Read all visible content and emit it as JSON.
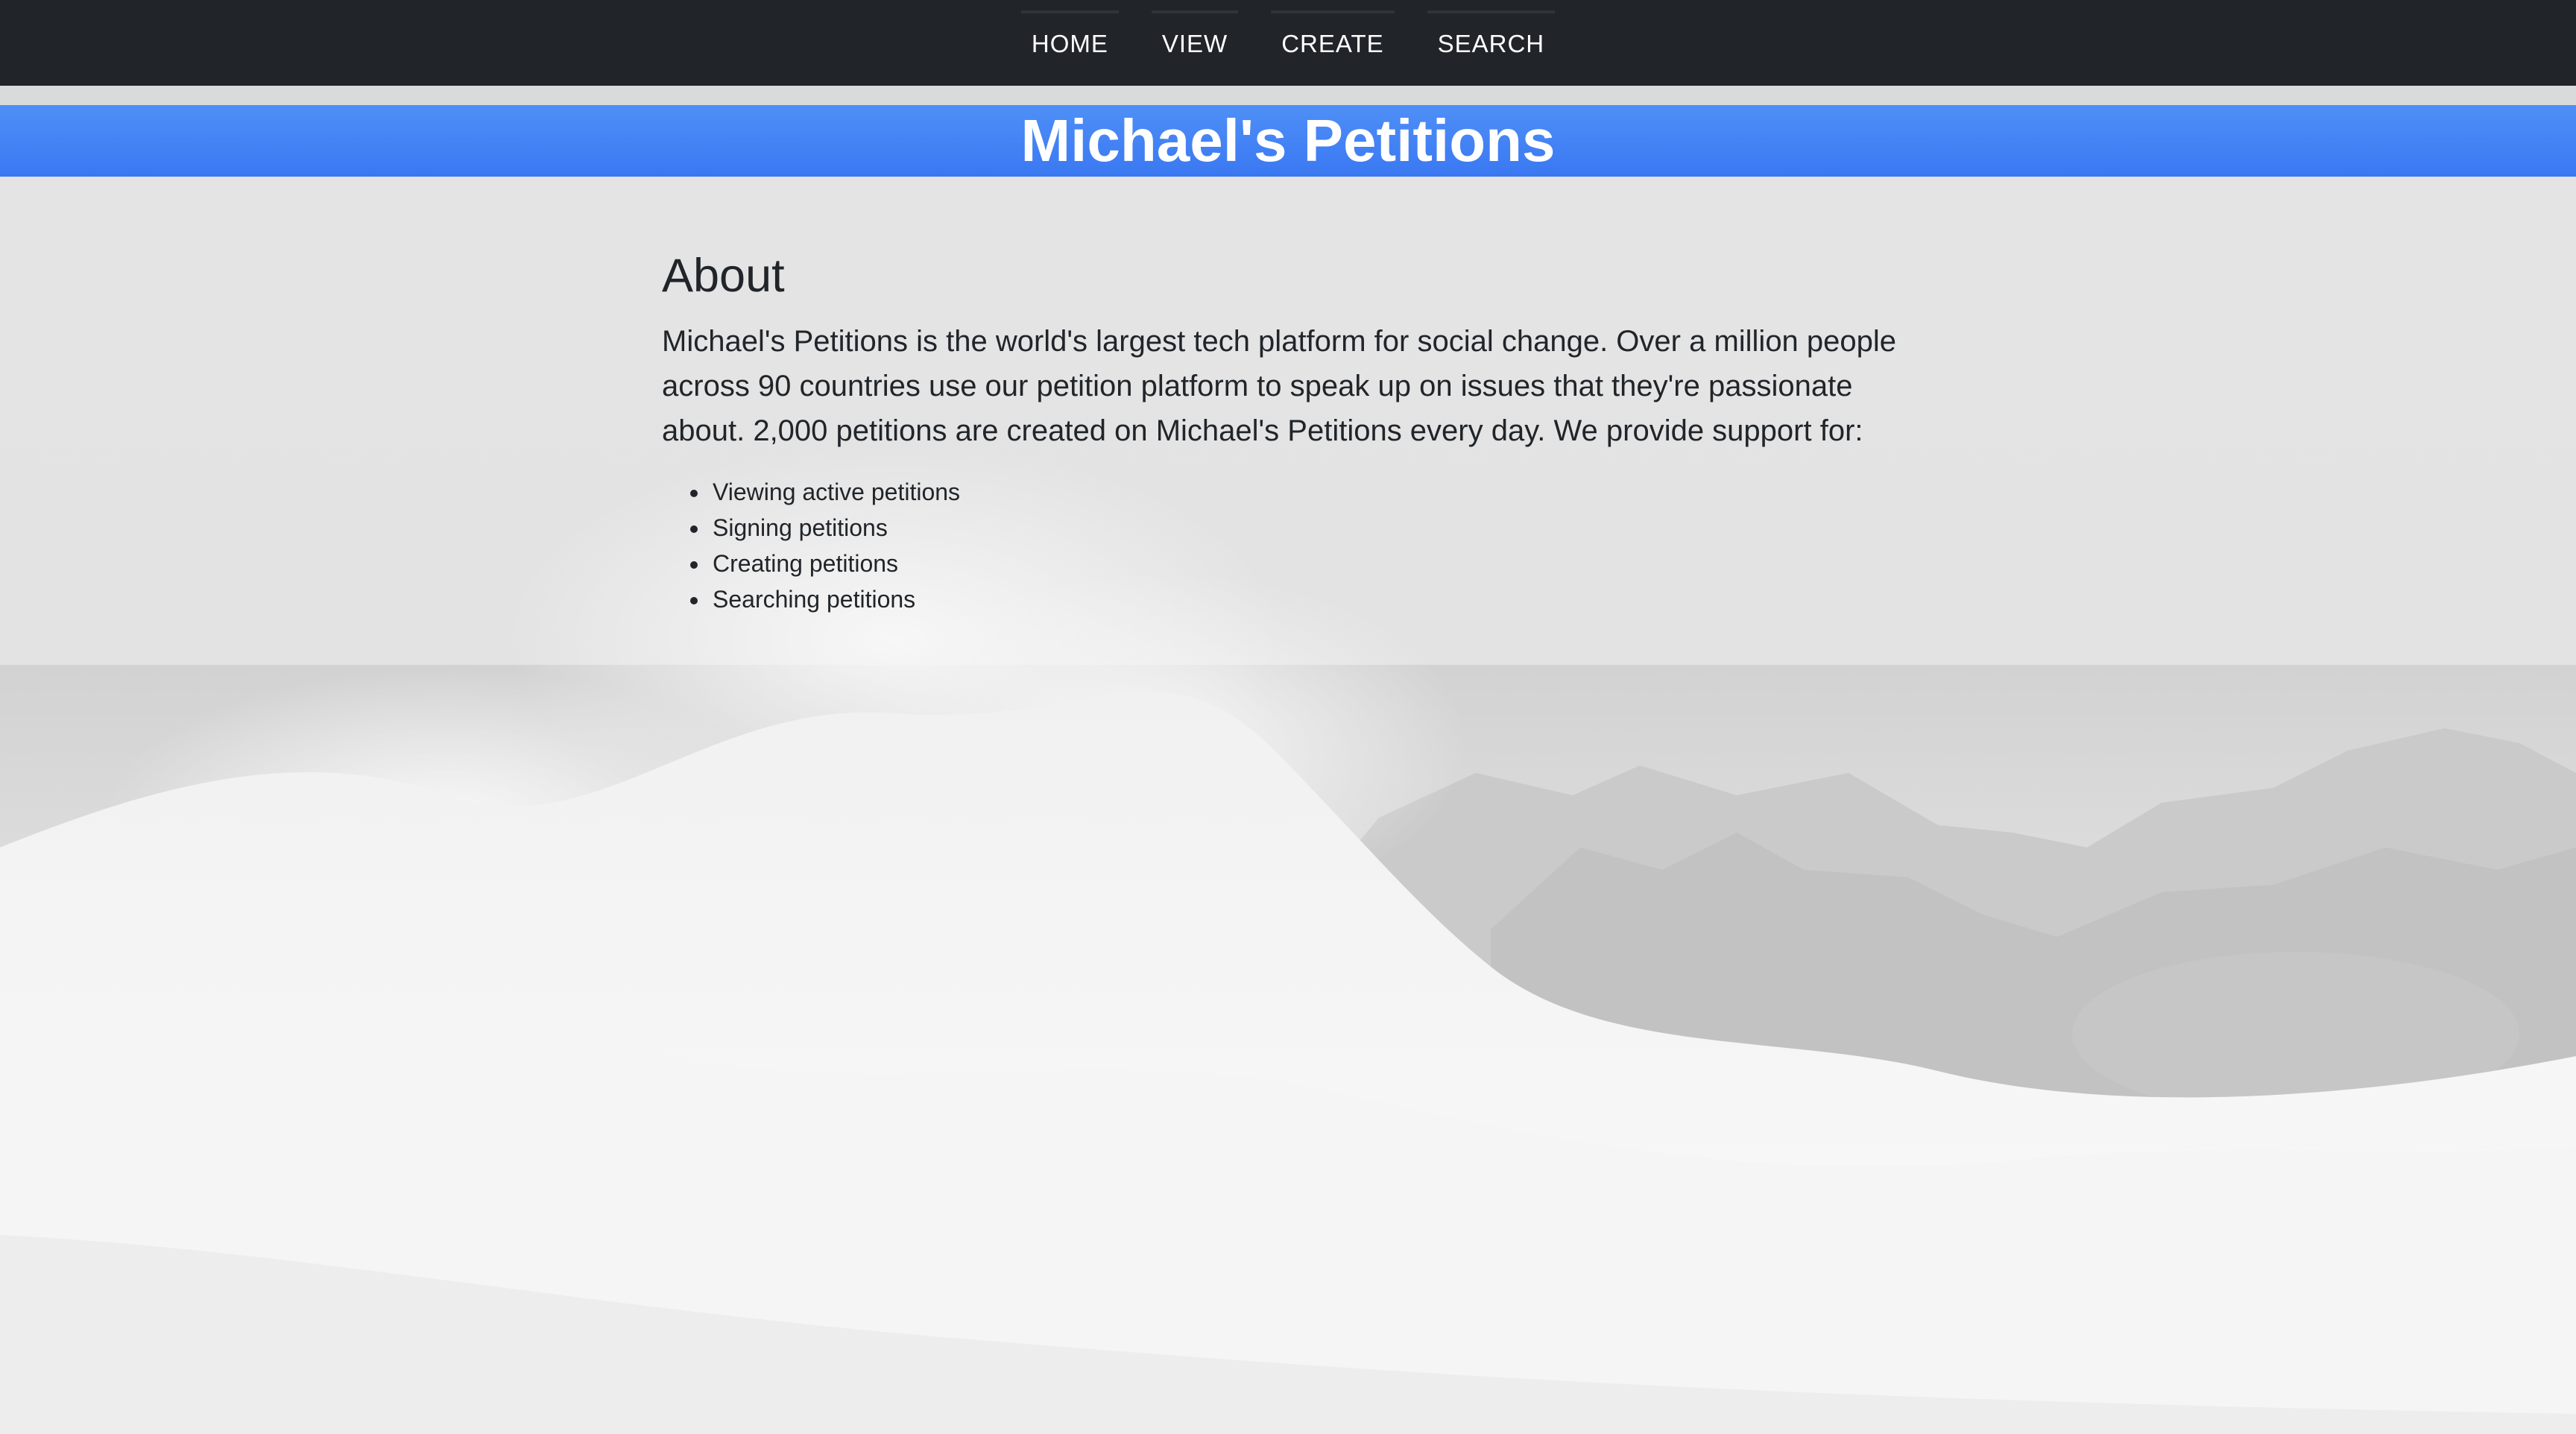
{
  "nav": {
    "items": [
      {
        "label": "HOME"
      },
      {
        "label": "VIEW"
      },
      {
        "label": "CREATE"
      },
      {
        "label": "SEARCH"
      }
    ]
  },
  "banner": {
    "title": "Michael's Petitions",
    "color": "#3f7ff4"
  },
  "about": {
    "heading": "About",
    "text": "Michael's Petitions is the world's largest tech platform for social change. Over a million people across 90 countries use our petition platform to speak up on issues that they're passionate about. 2,000 petitions are created on Michael's Petitions every day. We provide support for:",
    "features": [
      "Viewing active petitions",
      "Signing petitions",
      "Creating petitions",
      "Searching petitions"
    ]
  },
  "colors": {
    "navbar": "#212529",
    "background": "#e4e4e4",
    "text": "#212529"
  }
}
